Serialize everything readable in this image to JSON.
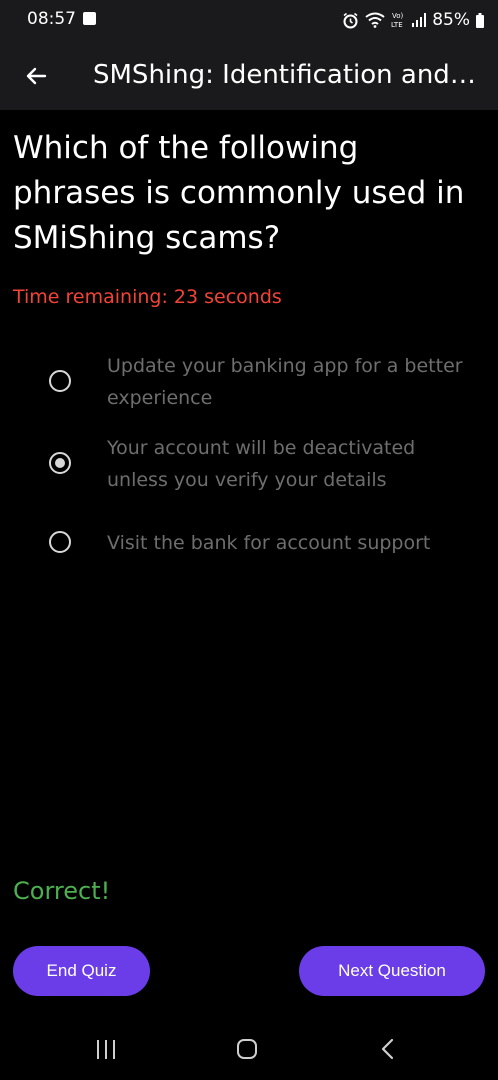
{
  "status_bar": {
    "time": "08:57",
    "battery": "85%",
    "icons": [
      "image-icon",
      "alarm-icon",
      "wifi-icon",
      "volte-lte-icon",
      "signal-icon",
      "battery-icon"
    ]
  },
  "app_bar": {
    "title": "SMShing: Identification and Response",
    "back_icon": "arrow-left-icon"
  },
  "quiz": {
    "question": "Which of the following phrases is commonly used in SMiShing scams?",
    "timer_text": "Time remaining: 23 seconds",
    "options": [
      {
        "label": "Update your banking app for a better experience",
        "selected": false
      },
      {
        "label": "Your account will be deactivated unless you verify your details",
        "selected": true
      },
      {
        "label": "Visit the bank for account support",
        "selected": false
      }
    ],
    "feedback": "Correct!",
    "end_quiz_label": "End Quiz",
    "next_question_label": "Next Question"
  },
  "nav_bar": {
    "icons": [
      "recent-apps-icon",
      "home-icon",
      "back-icon"
    ]
  },
  "colors": {
    "accent": "#6a3de8",
    "timer": "#f44336",
    "feedback": "#4caf50",
    "app_bar_bg": "#1a1a1d",
    "background": "#000000",
    "option_text": "#6e6e6e"
  }
}
